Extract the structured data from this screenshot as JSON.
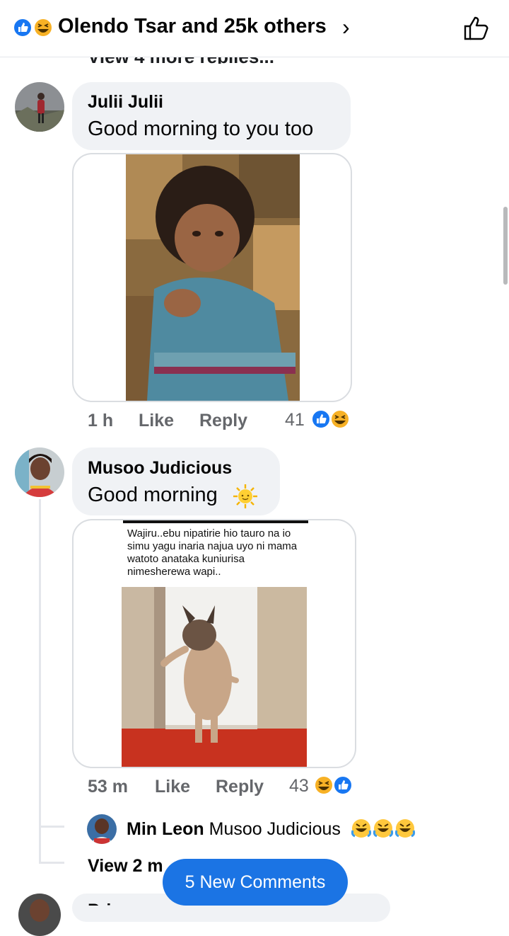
{
  "header": {
    "title": "Olendo Tsar and 25k others",
    "chevron": "›"
  },
  "view_more_replies_cut": "View 4 more replies...",
  "comments": [
    {
      "author": "Julii Julii",
      "text": "Good morning to you too",
      "time": "1 h",
      "like_label": "Like",
      "reply_label": "Reply",
      "reaction_count": "41"
    },
    {
      "author": "Musoo Judicious",
      "text": "Good morning",
      "time": "53 m",
      "like_label": "Like",
      "reply_label": "Reply",
      "reaction_count": "43",
      "meme_caption": "Wajiru..ebu nipatirie hio tauro na io simu yagu inaria najua uyo ni mama watoto anataka kuniurisa nimesherewa wapi..",
      "reply": {
        "author": "Min Leon",
        "text": "Musoo Judicious"
      },
      "view_more": "View 2 m"
    }
  ],
  "next_comment_author_cut": "Pri...",
  "new_comments_button": "5 New Comments",
  "colors": {
    "accent": "#1b74e4",
    "bubble": "#f0f2f5",
    "meta": "#65676b"
  }
}
